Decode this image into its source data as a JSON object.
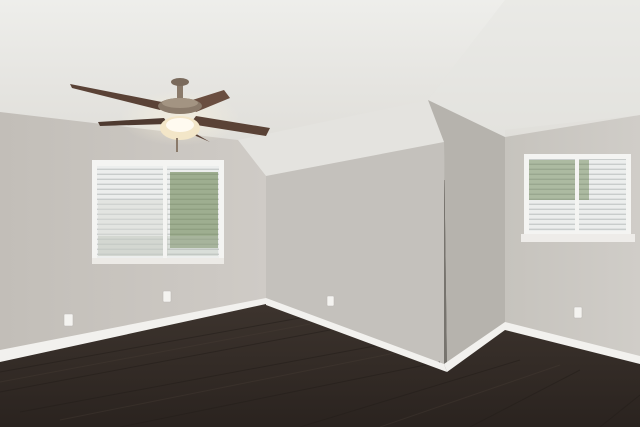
{
  "scene": {
    "subject": "empty room",
    "colors": {
      "ceiling": "#e9e8e4",
      "wall_left": "#c9c5c0",
      "wall_center": "#c4c1bc",
      "wall_alcove_side": "#b5b3ad",
      "wall_right": "#cbc8c2",
      "floor": "#3a312c",
      "floor_dark": "#2b2420",
      "baseboard": "#f2f1ee",
      "window_frame": "#f4f4f2",
      "blinds": "#e6e7e6",
      "foliage": "#5f7a44",
      "fan_blade": "#5a4236",
      "fan_metal": "#8a7a6a",
      "light_glass": "#f3e6c8"
    },
    "objects": [
      {
        "name": "ceiling-fan",
        "count": 1,
        "blades": 5
      },
      {
        "name": "window",
        "count": 2
      },
      {
        "name": "outlet",
        "count": 4
      }
    ]
  }
}
